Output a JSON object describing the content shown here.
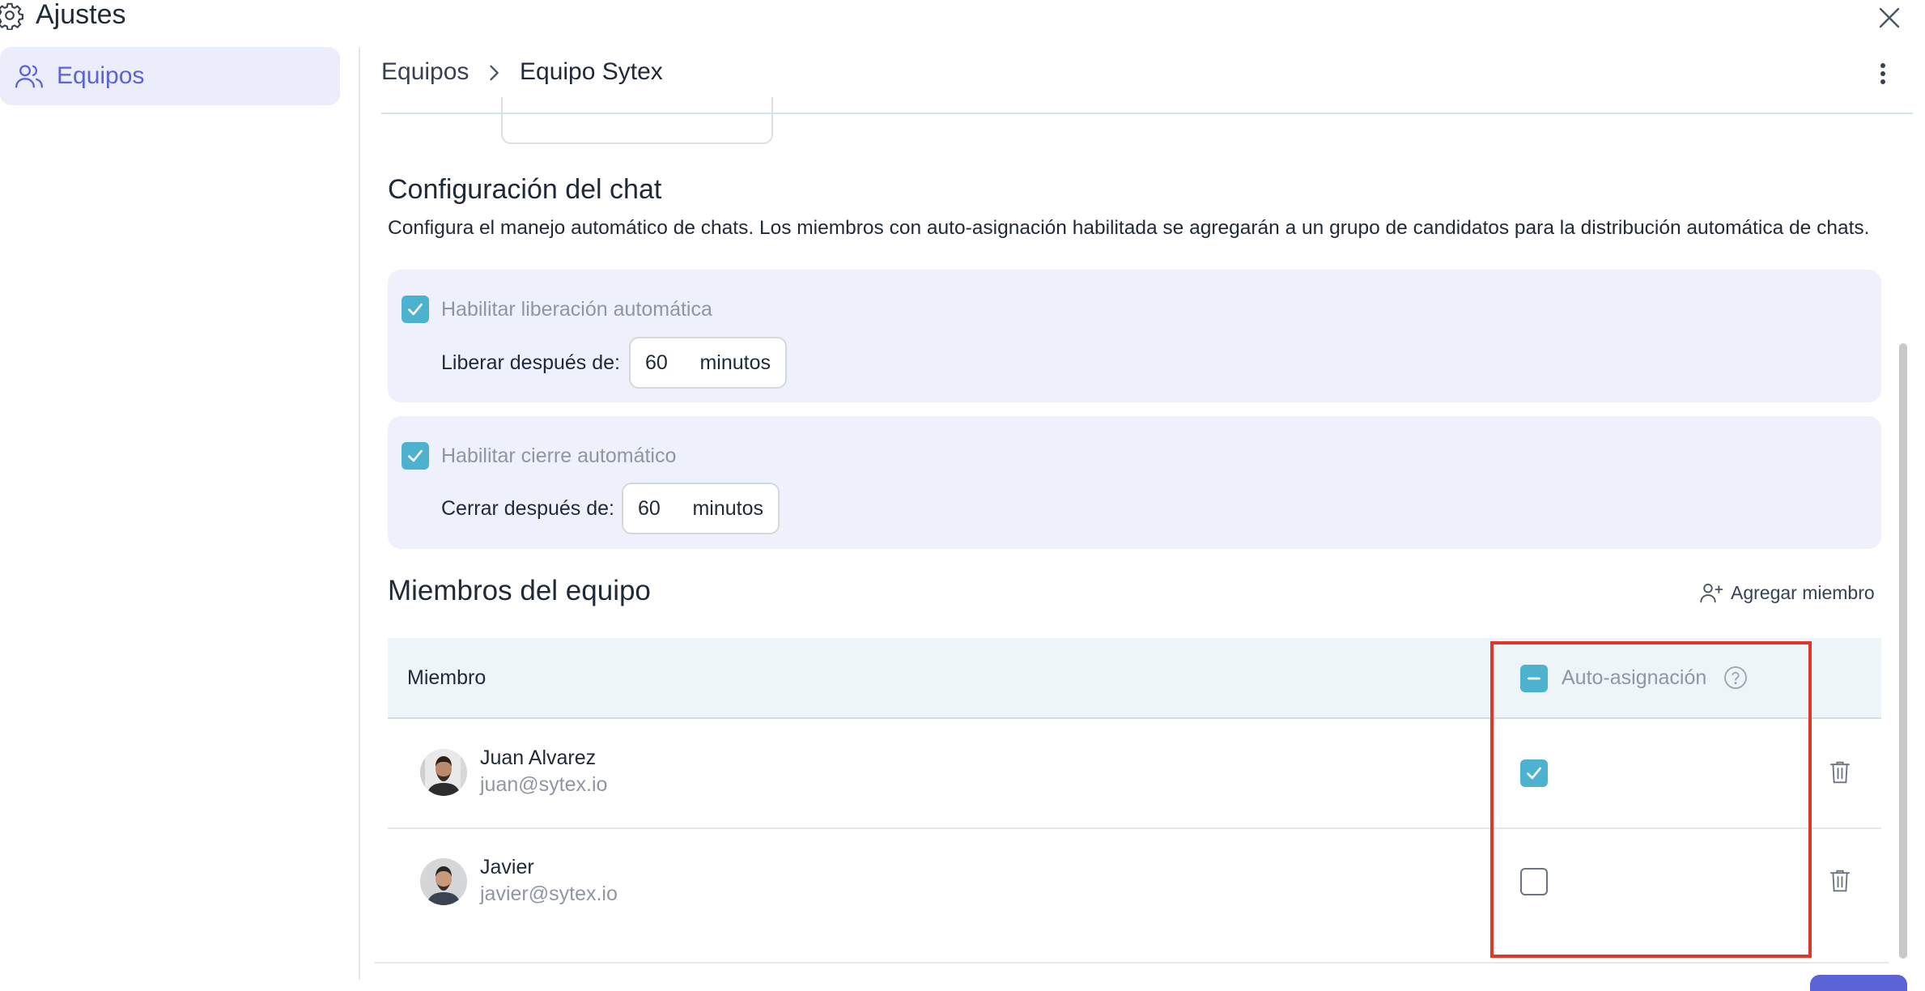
{
  "window": {
    "title": "Ajustes"
  },
  "sidebar": {
    "items": [
      {
        "label": "Equipos"
      }
    ]
  },
  "breadcrumb": {
    "root": "Equipos",
    "current": "Equipo Sytex"
  },
  "chat_config": {
    "title": "Configuración del chat",
    "description": "Configura el manejo automático de chats. Los miembros con auto-asignación habilitada se agregarán a un grupo de candidatos para la distribución automática de chats.",
    "auto_release": {
      "checkbox_label": "Habilitar liberación automática",
      "checked": true,
      "field_label": "Liberar después de:",
      "value": "60",
      "unit": "minutos"
    },
    "auto_close": {
      "checkbox_label": "Habilitar cierre automático",
      "checked": true,
      "field_label": "Cerrar después de:",
      "value": "60",
      "unit": "minutos"
    }
  },
  "members": {
    "title": "Miembros del equipo",
    "add_label": "Agregar miembro",
    "columns": {
      "member": "Miembro",
      "auto_assign": "Auto-asignación"
    },
    "header_checkbox_state": "indeterminate",
    "rows": [
      {
        "name": "Juan Alvarez",
        "email": "juan@sytex.io",
        "auto_assign": true
      },
      {
        "name": "Javier",
        "email": "javier@sytex.io",
        "auto_assign": false
      }
    ]
  },
  "colors": {
    "accent": "#5b63d6",
    "checkbox": "#4cb2cf",
    "highlight": "#e0362c",
    "panel_bg": "#eef0fb"
  }
}
